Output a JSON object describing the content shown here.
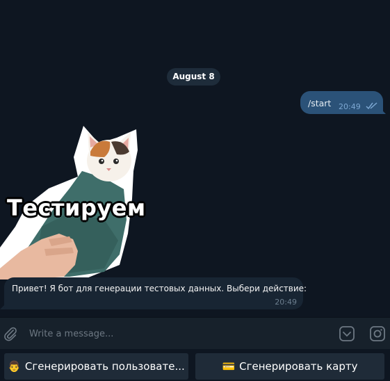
{
  "chat": {
    "date_separator": "August 8",
    "outgoing": {
      "text": "/start",
      "time": "20:49",
      "status": "read"
    },
    "sticker": {
      "caption": "Тестируем",
      "icon": "cat-sticker"
    },
    "incoming": {
      "text": "Привет! Я бот для генерации тестовых данных. Выбери действие:",
      "time": "20:49"
    }
  },
  "composer": {
    "placeholder": "Write a message...",
    "attach_icon": "paperclip-icon",
    "emoji_icon": "emoji-icon",
    "extra_icon": "instagram-icon"
  },
  "keyboard": {
    "buttons": [
      {
        "emoji": "👨",
        "label": "Сгенерировать пользовате..."
      },
      {
        "emoji": "💳",
        "label": "Сгенерировать карту"
      }
    ]
  },
  "colors": {
    "background": "#0e1621",
    "outgoing_bubble": "#2b5278",
    "incoming_bubble": "#182533",
    "accent": "#7da8d3"
  }
}
